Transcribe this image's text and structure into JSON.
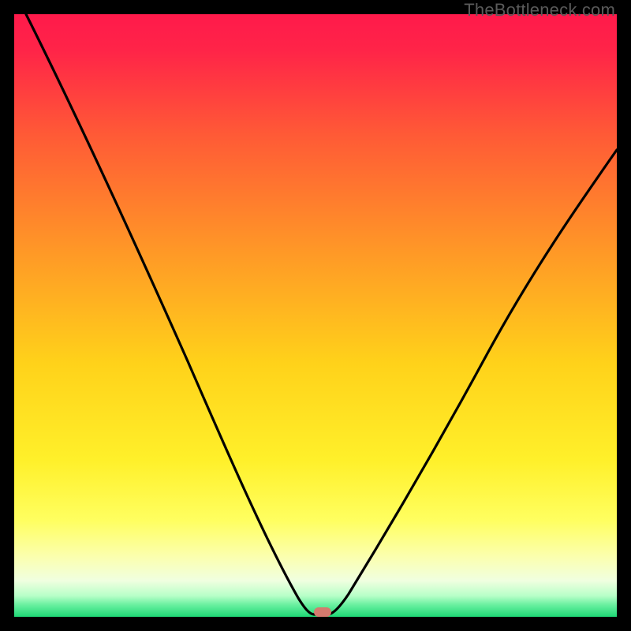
{
  "watermark": "TheBottleneck.com",
  "colors": {
    "gradient_top": "#ff1a4b",
    "gradient_mid1": "#ff7d2a",
    "gradient_mid2": "#ffd820",
    "gradient_low1": "#ffff66",
    "gradient_low2": "#fdffd0",
    "gradient_bottom": "#22e07a",
    "curve": "#000000",
    "marker": "#d47a6e",
    "frame": "#000000"
  },
  "chart_data": {
    "type": "line",
    "title": "",
    "xlabel": "",
    "ylabel": "",
    "xlim": [
      0,
      100
    ],
    "ylim": [
      0,
      100
    ],
    "x": [
      2,
      5,
      8,
      11,
      14,
      17,
      20,
      23,
      26,
      29,
      32,
      35,
      38,
      41,
      44,
      46,
      48,
      49,
      50,
      51,
      52,
      53,
      54,
      56,
      58,
      61,
      64,
      68,
      72,
      76,
      80,
      84,
      88,
      92,
      96,
      100
    ],
    "values": [
      100,
      94,
      88,
      82,
      76,
      70,
      64,
      58,
      52,
      46,
      40,
      34,
      28,
      22,
      16,
      11,
      6,
      3,
      1,
      0.3,
      0.3,
      1,
      3,
      7,
      12,
      19,
      26,
      33,
      40,
      47,
      53,
      59,
      64,
      69,
      74,
      78
    ],
    "annotations": [
      {
        "type": "flat_segment",
        "x_start": 49,
        "x_end": 52,
        "y": 0.15
      },
      {
        "type": "marker",
        "x": 50.5,
        "y": 0.6,
        "shape": "pill"
      }
    ],
    "notes": "Values are bottleneck percentage (0 = balanced, 100 = severe). Curve dips to ~0 near x≈50 then rises again; right branch rises to ~78% at x=100. No visible axis ticks or labels."
  }
}
